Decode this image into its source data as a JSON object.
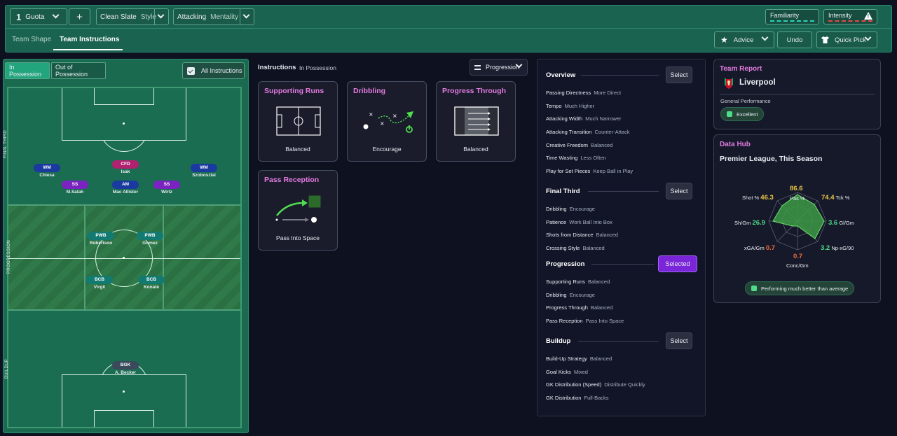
{
  "topbar": {
    "tactic_number": "1",
    "tactic_name": "Guota",
    "plus_label": "+",
    "style_value": "Clean Slate",
    "style_label": "Style",
    "mentality_value": "Attacking",
    "mentality_label": "Mentality",
    "familiarity_label": "Familiarity",
    "intensity_label": "Intensity",
    "tabs": [
      {
        "label": "Team Shape",
        "active": false
      },
      {
        "label": "Team Instructions",
        "active": true
      }
    ],
    "advice_label": "Advice",
    "undo_label": "Undo",
    "quick_pick_label": "Quick Pick"
  },
  "pitch": {
    "tab_in_possession": "In Possession",
    "tab_out_of_possession": "Out of Possession",
    "all_instructions_label": "All Instructions",
    "zones": {
      "top": "FINAL THIRD",
      "middle": "PROGRESSION",
      "bottom": "BUILDUP"
    },
    "players": [
      {
        "role": "CFD",
        "name": "Isak",
        "color": "#b0226f"
      },
      {
        "role": "WM",
        "name": "Chiesa",
        "color": "#1b3aa0"
      },
      {
        "role": "WM",
        "name": "Szoboszlai",
        "color": "#1b3aa0"
      },
      {
        "role": "SS",
        "name": "M.Salah",
        "color": "#7a23c0"
      },
      {
        "role": "AM",
        "name": "Mac Allister",
        "color": "#1b3aa0"
      },
      {
        "role": "SS",
        "name": "Wirtz",
        "color": "#7a23c0"
      },
      {
        "role": "PWB",
        "name": "Robertson",
        "color": "#137a72"
      },
      {
        "role": "PWB",
        "name": "Gomez",
        "color": "#137a72"
      },
      {
        "role": "BCB",
        "name": "Virgil",
        "color": "#137a72"
      },
      {
        "role": "BCB",
        "name": "Konaté",
        "color": "#137a72"
      },
      {
        "role": "BGK",
        "name": "A. Becker",
        "color": "#3a4a5a"
      }
    ]
  },
  "instructions": {
    "title": "Instructions",
    "subtitle": "In Possession",
    "dropdown_value": "Progression",
    "cards": [
      {
        "title": "Supporting Runs",
        "value": "Balanced"
      },
      {
        "title": "Dribbling",
        "value": "Encourage"
      },
      {
        "title": "Progress Through",
        "value": "Balanced"
      },
      {
        "title": "Pass Reception",
        "value": "Pass Into Space"
      }
    ]
  },
  "overview": {
    "sections": [
      {
        "title": "Overview",
        "button": "Select",
        "selected": false,
        "items": [
          {
            "k": "Passing Directness",
            "v": "More Direct"
          },
          {
            "k": "Tempo",
            "v": "Much Higher"
          },
          {
            "k": "Attacking Width",
            "v": "Much Narrower"
          },
          {
            "k": "Attacking Transition",
            "v": "Counter-Attack"
          },
          {
            "k": "Creative Freedom",
            "v": "Balanced"
          },
          {
            "k": "Time Wasting",
            "v": "Less Often"
          },
          {
            "k": "Play for Set Pieces",
            "v": "Keep Ball in Play"
          }
        ]
      },
      {
        "title": "Final Third",
        "button": "Select",
        "selected": false,
        "items": [
          {
            "k": "Dribbling",
            "v": "Encourage"
          },
          {
            "k": "Patience",
            "v": "Work Ball Into Box"
          },
          {
            "k": "Shots from Distance",
            "v": "Balanced"
          },
          {
            "k": "Crossing Style",
            "v": "Balanced"
          }
        ]
      },
      {
        "title": "Progression",
        "button": "Selected",
        "selected": true,
        "items": [
          {
            "k": "Supporting Runs",
            "v": "Balanced"
          },
          {
            "k": "Dribbling",
            "v": "Encourage"
          },
          {
            "k": "Progress Through",
            "v": "Balanced"
          },
          {
            "k": "Pass Reception",
            "v": "Pass Into Space"
          }
        ]
      },
      {
        "title": "Buildup",
        "button": "Select",
        "selected": false,
        "items": [
          {
            "k": "Build-Up Strategy",
            "v": "Balanced"
          },
          {
            "k": "Goal Kicks",
            "v": "Mixed"
          },
          {
            "k": "GK Distribution (Speed)",
            "v": "Distribute Quickly"
          },
          {
            "k": "GK Distribution",
            "v": "Full-Backs"
          }
        ]
      }
    ]
  },
  "team_report": {
    "title": "Team Report",
    "club": "Liverpool",
    "general_label": "General Performance",
    "rating": "Excellent"
  },
  "data_hub": {
    "title": "Data Hub",
    "subtitle": "Premier League, This Season",
    "stats": [
      {
        "label": "Pas %",
        "value": "86.6",
        "color": "#e8c547"
      },
      {
        "label": "Tck %",
        "value": "74.4",
        "color": "#e8c547"
      },
      {
        "label": "Gl/Gm",
        "value": "3.6",
        "color": "#4fdc8a"
      },
      {
        "label": "Np-xG/90",
        "value": "3.2",
        "color": "#4fdc8a"
      },
      {
        "label": "Conc/Gm",
        "value": "0.7",
        "color": "#f06a3a"
      },
      {
        "label": "xGA/Gm",
        "value": "0.7",
        "color": "#f06a3a"
      },
      {
        "label": "Sh/Gm",
        "value": "26.9",
        "color": "#4fdc8a"
      },
      {
        "label": "Shot %",
        "value": "46.3",
        "color": "#e8c547"
      }
    ],
    "verdict": "Performing much better than average"
  }
}
